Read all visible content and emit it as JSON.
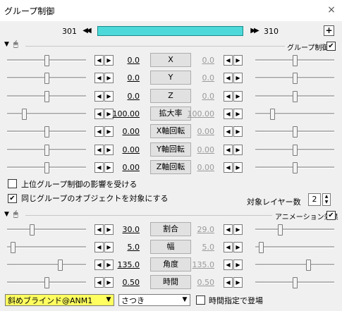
{
  "window": {
    "title": "グループ制御",
    "close_label": "×"
  },
  "timeline": {
    "start_frame": "301",
    "end_frame": "310",
    "prev_label": "◀◀",
    "next_label": "▶▶",
    "add_label": "+"
  },
  "group_section": {
    "label": "グループ制御",
    "checked": true
  },
  "parameters": [
    {
      "name": "X",
      "value": "0.0",
      "end_value": "0.0",
      "left_pos": 0.5,
      "right_pos": 0.5
    },
    {
      "name": "Y",
      "value": "0.0",
      "end_value": "0.0",
      "left_pos": 0.5,
      "right_pos": 0.5
    },
    {
      "name": "Z",
      "value": "0.0",
      "end_value": "0.0",
      "left_pos": 0.5,
      "right_pos": 0.5
    },
    {
      "name": "拡大率",
      "value": "100.00",
      "end_value": "100.00",
      "left_pos": 0.2,
      "right_pos": 0.2
    },
    {
      "name": "X軸回転",
      "value": "0.00",
      "end_value": "0.00",
      "left_pos": 0.5,
      "right_pos": 0.5
    },
    {
      "name": "Y軸回転",
      "value": "0.00",
      "end_value": "0.00",
      "left_pos": 0.5,
      "right_pos": 0.5
    },
    {
      "name": "Z軸回転",
      "value": "0.00",
      "end_value": "0.00",
      "left_pos": 0.5,
      "right_pos": 0.5
    }
  ],
  "options": {
    "upper_group_label": "上位グループ制御の影響を受ける",
    "upper_group_checked": false,
    "same_group_label": "同じグループのオブジェクトを対象にする",
    "same_group_checked": true,
    "layer_count_label": "対象レイヤー数",
    "layer_count_value": "2"
  },
  "animation_section": {
    "label": "アニメーション効果",
    "checked": true
  },
  "anim_parameters": [
    {
      "name": "割合",
      "value": "30.0",
      "end_value": "29.0",
      "left_pos": 0.3,
      "right_pos": 0.3
    },
    {
      "name": "幅",
      "value": "5.0",
      "end_value": "5.0",
      "left_pos": 0.05,
      "right_pos": 0.05
    },
    {
      "name": "角度",
      "value": "135.0",
      "end_value": "135.0",
      "left_pos": 0.68,
      "right_pos": 0.68
    },
    {
      "name": "時間",
      "value": "0.50",
      "end_value": "0.50",
      "left_pos": 0.5,
      "right_pos": 0.5
    }
  ],
  "footer": {
    "effect_select": "斜めブラインド@ANM1",
    "type_select": "さつき",
    "time_label": "時間指定で登場",
    "time_checked": false
  }
}
